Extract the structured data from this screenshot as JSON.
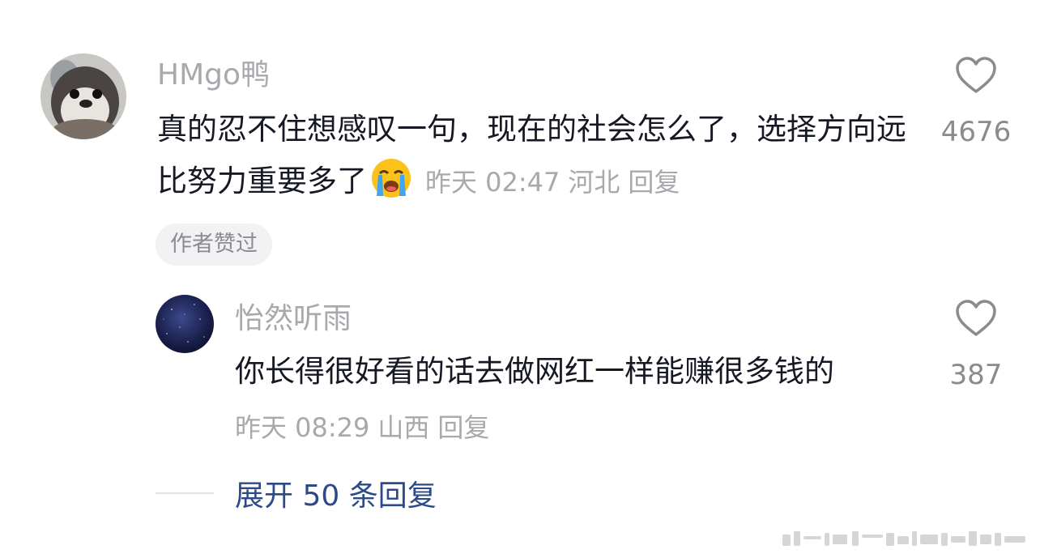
{
  "comment": {
    "username": "HMgo鸭",
    "text": "真的忍不住想感叹一句，现在的社会怎么了，选择方向远比努力重要多了",
    "emoji": "loudly-crying-face-icon",
    "time": "昨天 02:47",
    "location": "河北",
    "reply_label": "回复",
    "likes": "4676",
    "badge": "作者赞过"
  },
  "reply": {
    "username": "怡然听雨",
    "text": "你长得很好看的话去做网红一样能赚很多钱的",
    "time": "昨天 08:29",
    "location": "山西",
    "reply_label": "回复",
    "likes": "387"
  },
  "expand_label": "展开 50 条回复",
  "colors": {
    "text_primary": "#161823",
    "text_secondary": "#a8a8ad",
    "link": "#2c4a8a",
    "badge_bg": "#f2f2f4"
  }
}
